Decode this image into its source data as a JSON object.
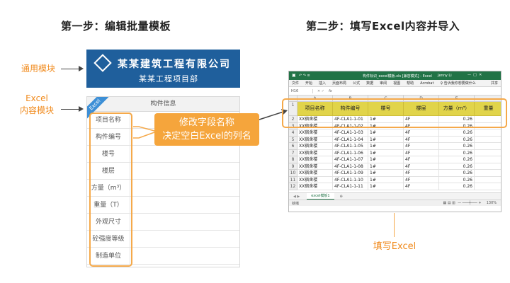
{
  "step1_title": "第一步：编辑批量模板",
  "step2_title": "第二步：填写Excel内容并导入",
  "labels": {
    "general_module": "通用模块",
    "excel_module_line1": "Excel",
    "excel_module_line2": "内容模块",
    "fill_excel": "填写Excel"
  },
  "logo": {
    "company": "某某建筑工程有限公司",
    "project": "某某工程项目部"
  },
  "form": {
    "ribbon": "Excel",
    "header": "构件信息",
    "fields": [
      "项目名称",
      "构件编号",
      "楼号",
      "楼层",
      "方量（m³）",
      "重量（T）",
      "外观尺寸",
      "砼强度等级",
      "制造单位"
    ]
  },
  "callout": {
    "line1": "修改字段名称",
    "line2": "决定空白Excel的列名"
  },
  "excel": {
    "window_title": "构件标识_excel模板.xls [兼容模式] - Excel",
    "user": "Jenny Li",
    "ribbon_tabs": [
      "文件",
      "开始",
      "插入",
      "页面布局",
      "公式",
      "数据",
      "审阅",
      "视图",
      "帮助",
      "Acrobat",
      "♀ 告诉我你想要做什么",
      "共享"
    ],
    "name_box": "H16",
    "fx": "fx",
    "col_letters": [
      "A",
      "B",
      "C",
      "D",
      "E"
    ],
    "headers": [
      "项目名称",
      "构件编号",
      "楼号",
      "楼层",
      "方量（m³）",
      "重量"
    ],
    "rows": [
      {
        "num": "2",
        "a": "XX宿舍楼",
        "b": "4F-CLA1-1-01",
        "c": "1#",
        "d": "4F",
        "e": "0.26"
      },
      {
        "num": "3",
        "a": "XX宿舍楼",
        "b": "4F-CLA1-1-02",
        "c": "1#",
        "d": "4F",
        "e": "0.26"
      },
      {
        "num": "4",
        "a": "XX宿舍楼",
        "b": "4F-CLA1-1-03",
        "c": "1#",
        "d": "4F",
        "e": "0.26"
      },
      {
        "num": "5",
        "a": "XX宿舍楼",
        "b": "4F-CLA1-1-04",
        "c": "1#",
        "d": "4F",
        "e": "0.26"
      },
      {
        "num": "6",
        "a": "XX宿舍楼",
        "b": "4F-CLA1-1-05",
        "c": "1#",
        "d": "4F",
        "e": "0.26"
      },
      {
        "num": "7",
        "a": "XX宿舍楼",
        "b": "4F-CLA1-1-06",
        "c": "1#",
        "d": "4F",
        "e": "0.26"
      },
      {
        "num": "8",
        "a": "XX宿舍楼",
        "b": "4F-CLA1-1-07",
        "c": "1#",
        "d": "4F",
        "e": "0.26"
      },
      {
        "num": "9",
        "a": "XX宿舍楼",
        "b": "4F-CLA1-1-08",
        "c": "1#",
        "d": "4F",
        "e": "0.26"
      },
      {
        "num": "10",
        "a": "XX宿舍楼",
        "b": "4F-CLA1-1-09",
        "c": "1#",
        "d": "4F",
        "e": "0.26"
      },
      {
        "num": "11",
        "a": "XX宿舍楼",
        "b": "4F-CLA1-1-10",
        "c": "1#",
        "d": "4F",
        "e": "0.26"
      },
      {
        "num": "12",
        "a": "XX宿舍楼",
        "b": "4F-CLA1-1-11",
        "c": "1#",
        "d": "4F",
        "e": "0.26"
      }
    ],
    "sheet_tab": "excel模板1",
    "status_left": "就绪",
    "zoom": "130%"
  },
  "colors": {
    "orange": "#f08a1c",
    "excel_green": "#217346",
    "header_yellow": "#e1d44a",
    "logo_blue": "#1f5f9c"
  }
}
